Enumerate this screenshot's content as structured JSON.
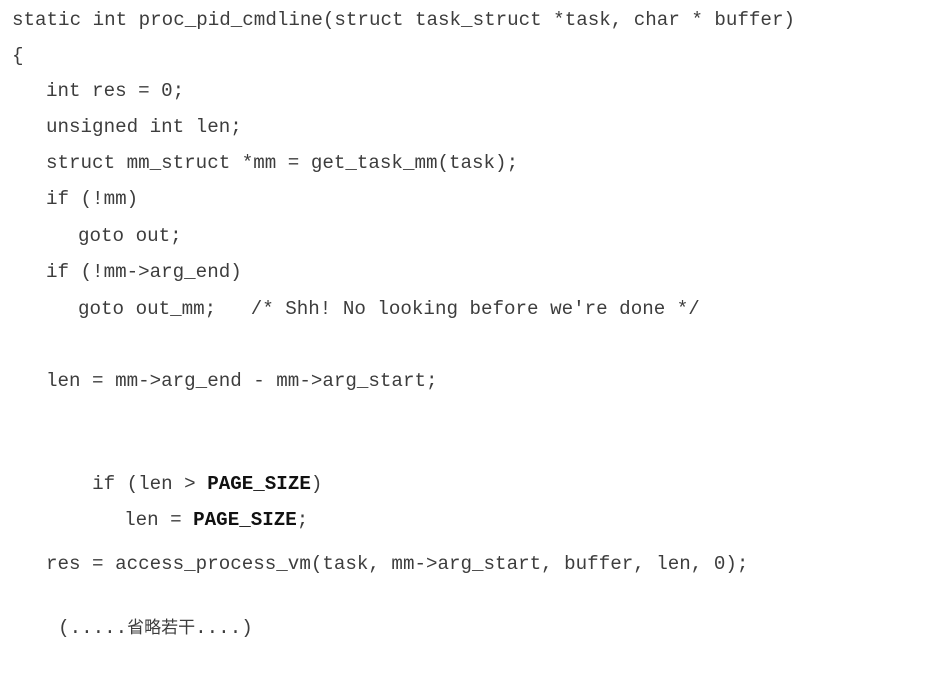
{
  "document": {
    "language": "c",
    "lines": [
      {
        "text": "static int proc_pid_cmdline(struct task_struct *task, char * buffer)"
      },
      {
        "text": "{"
      },
      {
        "text": "int res = 0;"
      },
      {
        "text": "unsigned int len;"
      },
      {
        "text": "struct mm_struct *mm = get_task_mm(task);"
      },
      {
        "text": "if (!mm)"
      },
      {
        "text": "goto out;"
      },
      {
        "text": "if (!mm->arg_end)"
      },
      {
        "text": "goto out_mm;   /* Shh! No looking before we're done */"
      },
      {
        "text": "len = mm->arg_end - mm->arg_start;"
      },
      {
        "pre": "if (len > ",
        "bold": "PAGE_SIZE",
        "post": ")"
      },
      {
        "pre": "len = ",
        "bold": "PAGE_SIZE",
        "post": ";"
      },
      {
        "text": "res = access_process_vm(task, mm->arg_start, buffer, len, 0);"
      },
      {
        "pre": "(.....",
        "cn": "省略若干",
        "post": "....)"
      }
    ]
  }
}
